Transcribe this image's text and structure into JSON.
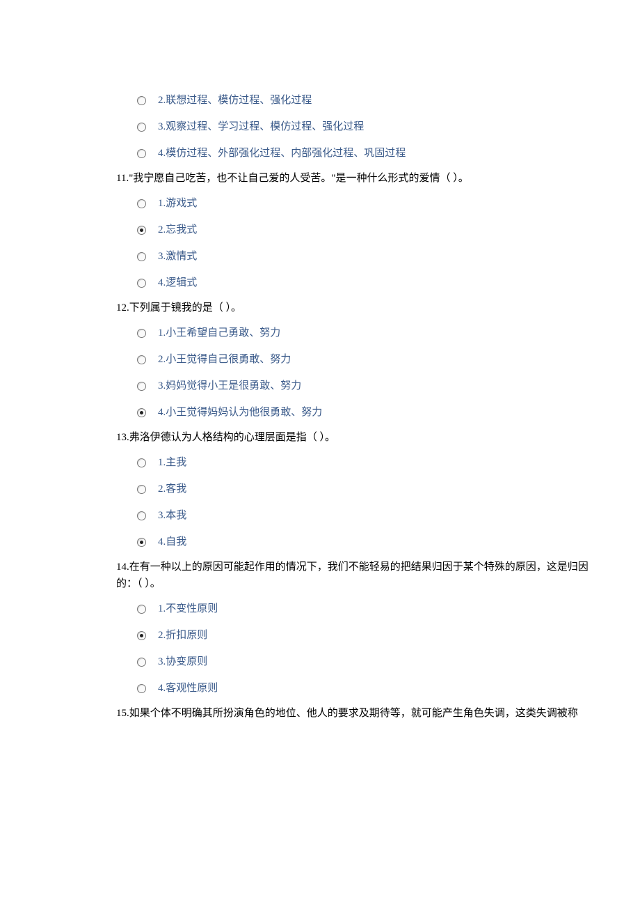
{
  "stray_options": [
    {
      "label": "2.联想过程、模仿过程、强化过程",
      "selected": false
    },
    {
      "label": "3.观察过程、学习过程、模仿过程、强化过程",
      "selected": false
    },
    {
      "label": "4.模仿过程、外部强化过程、内部强化过程、巩固过程",
      "selected": false
    }
  ],
  "questions": [
    {
      "number": "11",
      "text": "11.\"我宁愿自己吃苦，也不让自己爱的人受苦。\"是一种什么形式的爱情（  ）。",
      "options": [
        {
          "label": "1.游戏式",
          "selected": false
        },
        {
          "label": "2.忘我式",
          "selected": true
        },
        {
          "label": "3.激情式",
          "selected": false
        },
        {
          "label": "4.逻辑式",
          "selected": false
        }
      ]
    },
    {
      "number": "12",
      "text": "12.下列属于镜我的是（  ）。",
      "options": [
        {
          "label": "1.小王希望自己勇敢、努力",
          "selected": false
        },
        {
          "label": "2.小王觉得自己很勇敢、努力",
          "selected": false
        },
        {
          "label": "3.妈妈觉得小王是很勇敢、努力",
          "selected": false
        },
        {
          "label": "4.小王觉得妈妈认为他很勇敢、努力",
          "selected": true
        }
      ]
    },
    {
      "number": "13",
      "text": "13.弗洛伊德认为人格结构的心理层面是指（  ）。",
      "options": [
        {
          "label": "1.主我",
          "selected": false
        },
        {
          "label": "2.客我",
          "selected": false
        },
        {
          "label": "3.本我",
          "selected": false
        },
        {
          "label": "4.自我",
          "selected": true
        }
      ]
    },
    {
      "number": "14",
      "text": "14.在有一种以上的原因可能起作用的情况下，我们不能轻易的把结果归因于某个特殊的原因，这是归因的：（  ）。",
      "options": [
        {
          "label": "1.不变性原则",
          "selected": false
        },
        {
          "label": "2.折扣原则",
          "selected": true
        },
        {
          "label": "3.协变原则",
          "selected": false
        },
        {
          "label": "4.客观性原则",
          "selected": false
        }
      ]
    }
  ],
  "trailing_question": {
    "number": "15",
    "text": "15.如果个体不明确其所扮演角色的地位、他人的要求及期待等，就可能产生角色失调，这类失调被称"
  }
}
